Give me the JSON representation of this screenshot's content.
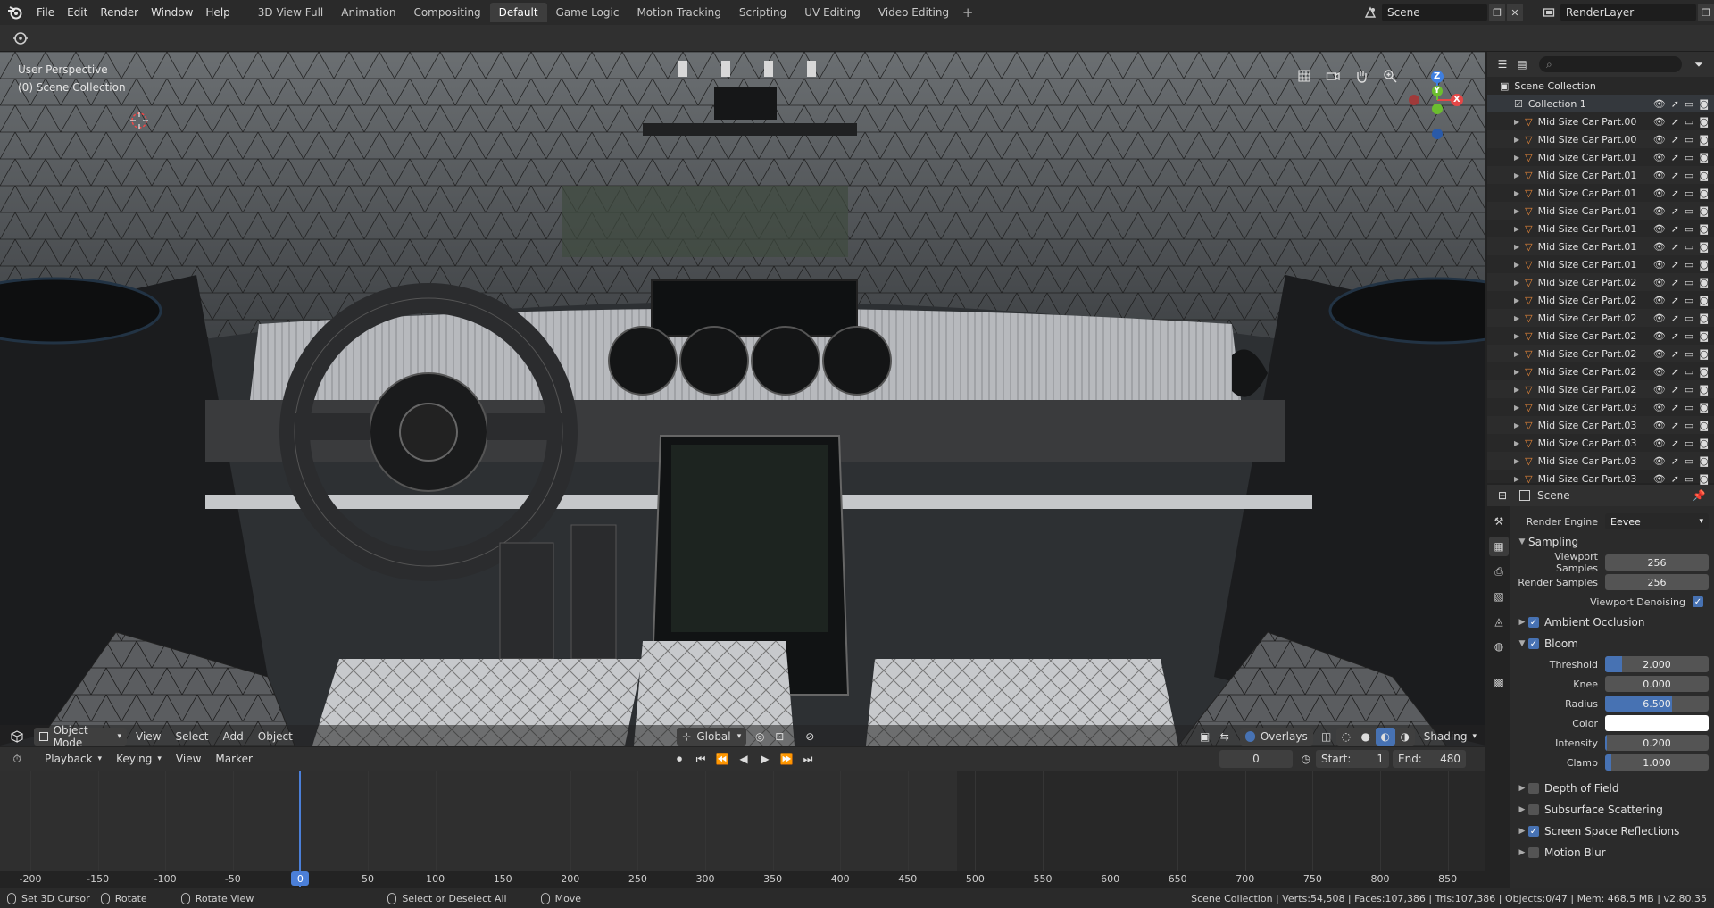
{
  "menu": [
    "File",
    "Edit",
    "Render",
    "Window",
    "Help"
  ],
  "workspaces": [
    "3D View Full",
    "Animation",
    "Compositing",
    "Default",
    "Game Logic",
    "Motion Tracking",
    "Scripting",
    "UV Editing",
    "Video Editing"
  ],
  "active_workspace": "Default",
  "scene": {
    "name": "Scene"
  },
  "render_layer": {
    "name": "RenderLayer"
  },
  "viewport": {
    "perspective": "User Perspective",
    "collection": "(0) Scene Collection",
    "mode": "Object Mode",
    "menus": [
      "View",
      "Select",
      "Add",
      "Object"
    ],
    "transform": "Global",
    "overlays": "Overlays",
    "shading": "Shading",
    "gizmo": {
      "x": "X",
      "y": "Y",
      "z": "Z"
    }
  },
  "timeline": {
    "menus": [
      "Playback",
      "Keying",
      "View",
      "Marker"
    ],
    "current_frame": "0",
    "start_label": "Start:",
    "start": "1",
    "end_label": "End:",
    "end": "480",
    "ruler": [
      "-200",
      "-150",
      "-100",
      "-50",
      "0",
      "50",
      "100",
      "150",
      "200",
      "250",
      "300",
      "350",
      "400",
      "450",
      "500",
      "550",
      "600",
      "650",
      "700",
      "750",
      "800",
      "850"
    ],
    "playhead": "0"
  },
  "status": {
    "left": [
      {
        "icon": "mouse-left-icon",
        "label": "Set 3D Cursor"
      },
      {
        "icon": "mouse-middle-icon",
        "label": "Rotate"
      },
      {
        "icon": "mouse-right-icon",
        "label": "Rotate View"
      },
      {
        "icon": "mouse-left-icon",
        "label": "Select or Deselect All"
      },
      {
        "icon": "mouse-drag-icon",
        "label": "Move"
      }
    ],
    "right": "Scene Collection | Verts:54,508 | Faces:107,386 | Tris:107,386 | Objects:0/47 | Mem: 468.5 MB | v2.80.35"
  },
  "outliner": {
    "root": "Scene Collection",
    "collection": "Collection 1",
    "items": [
      "Mid Size Car Part.00",
      "Mid Size Car Part.00",
      "Mid Size Car Part.01",
      "Mid Size Car Part.01",
      "Mid Size Car Part.01",
      "Mid Size Car Part.01",
      "Mid Size Car Part.01",
      "Mid Size Car Part.01",
      "Mid Size Car Part.01",
      "Mid Size Car Part.02",
      "Mid Size Car Part.02",
      "Mid Size Car Part.02",
      "Mid Size Car Part.02",
      "Mid Size Car Part.02",
      "Mid Size Car Part.02",
      "Mid Size Car Part.02",
      "Mid Size Car Part.03",
      "Mid Size Car Part.03",
      "Mid Size Car Part.03",
      "Mid Size Car Part.03",
      "Mid Size Car Part.03"
    ]
  },
  "properties": {
    "context": "Scene",
    "render_engine_label": "Render Engine",
    "render_engine": "Eevee",
    "sampling": "Sampling",
    "viewport_samples_label": "Viewport Samples",
    "viewport_samples": "256",
    "render_samples_label": "Render Samples",
    "render_samples": "256",
    "denoise_label": "Viewport Denoising",
    "ambient_occlusion": "Ambient Occlusion",
    "bloom": "Bloom",
    "threshold_label": "Threshold",
    "threshold": "2.000",
    "knee_label": "Knee",
    "knee": "0.000",
    "radius_label": "Radius",
    "radius": "6.500",
    "color_label": "Color",
    "intensity_label": "Intensity",
    "intensity": "0.200",
    "clamp_label": "Clamp",
    "clamp": "1.000",
    "sections": [
      "Depth of Field",
      "Subsurface Scattering",
      "Screen Space Reflections",
      "Motion Blur"
    ],
    "section_checked": [
      false,
      false,
      true,
      false
    ]
  },
  "colors": {
    "accent": "#4772b3",
    "playhead": "#4b7fd8",
    "mesh_icon": "#e8883a",
    "axis_x": "#e54747",
    "axis_y": "#6cbe2f",
    "axis_z": "#3f7fe0"
  }
}
